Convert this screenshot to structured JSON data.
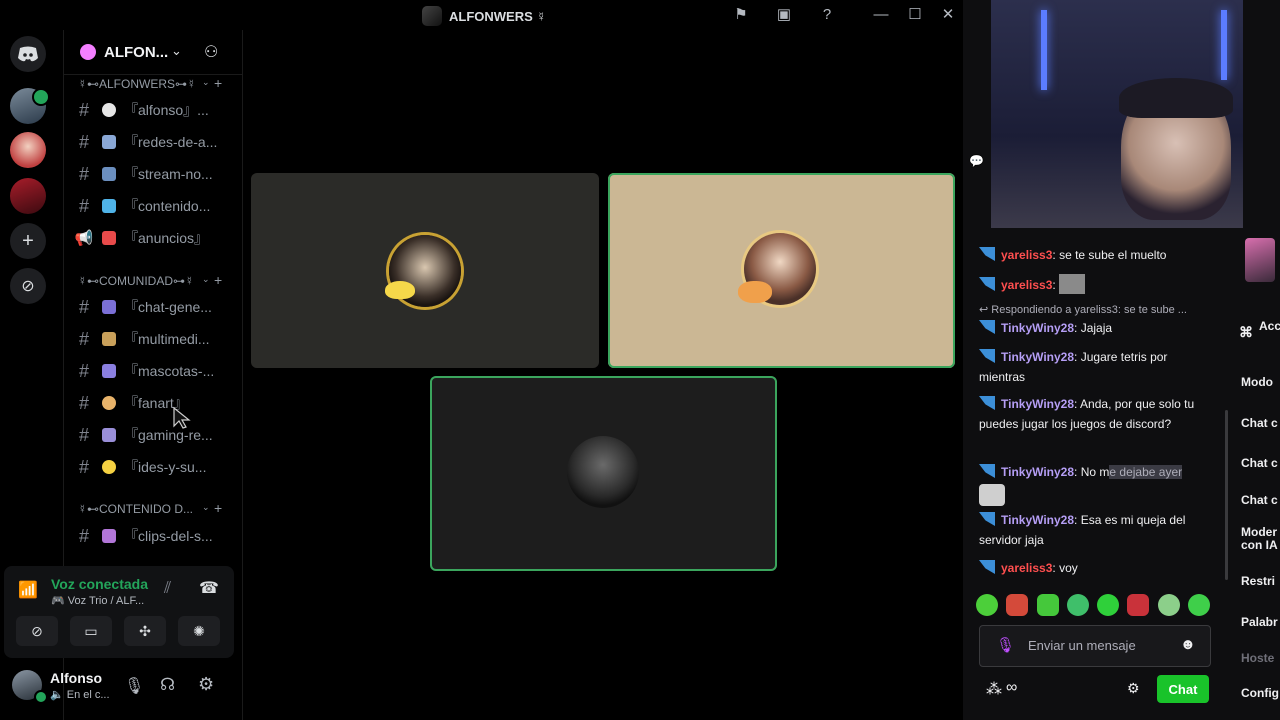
{
  "window": {
    "title": "ALFONWERS ☿"
  },
  "server": {
    "name": "ALFON...",
    "categories": [
      {
        "label": "☿⊷ALFONWERS⊶☿"
      },
      {
        "label": "☿⊷COMUNIDAD⊶☿"
      },
      {
        "label": "☿⊷CONTENIDO D..."
      }
    ],
    "channels": [
      {
        "label": "『alfonso』..."
      },
      {
        "label": "『redes-de-a..."
      },
      {
        "label": "『stream-no..."
      },
      {
        "label": "『contenido..."
      },
      {
        "label": "『anuncios』"
      },
      {
        "label": "『chat-gene..."
      },
      {
        "label": "『multimedi..."
      },
      {
        "label": "『mascotas-..."
      },
      {
        "label": "『fanart』"
      },
      {
        "label": "『gaming-re..."
      },
      {
        "label": "『ides-y-su..."
      },
      {
        "label": "『clips-del-s..."
      }
    ]
  },
  "voice": {
    "status": "Voz conectada",
    "channel": "🎮 Voz Trio / ALF..."
  },
  "user": {
    "name": "Alfonso",
    "status": "🔈 En el c..."
  },
  "stream_chat": {
    "messages": [
      {
        "user": "yareliss3",
        "text": "se te sube el muelto"
      },
      {
        "user": "yareliss3",
        "text": ""
      },
      {
        "reply": "↩ Respondiendo a yareliss3: se te sube ..."
      },
      {
        "user": "TinkyWiny28",
        "text": "Jajaja"
      },
      {
        "user": "TinkyWiny28",
        "text": "Jugare tetris por mientras"
      },
      {
        "user": "TinkyWiny28",
        "text": "Anda, por que solo tu puedes jugar los juegos de discord?"
      },
      {
        "user": "TinkyWiny28",
        "text_a": "No m",
        "text_b": "e dejabe ayer"
      },
      {
        "user": "TinkyWiny28",
        "text": "Esa es mi queja del servidor jaja"
      },
      {
        "user": "yareliss3",
        "text": "voy"
      }
    ],
    "input_placeholder": "Enviar un mensaje",
    "send_label": "Chat",
    "sep": ":"
  },
  "side_menu": {
    "items": [
      "Acc car",
      "Modo",
      "Chat c",
      "Chat c",
      "Chat c",
      "Moder con IA",
      "Restri",
      "Palabr",
      "Hoste",
      "Config"
    ]
  },
  "colors": {
    "speaking_border": "#3ba55d",
    "connected_green": "#23a55a",
    "twitch_green": "#19c32a"
  }
}
